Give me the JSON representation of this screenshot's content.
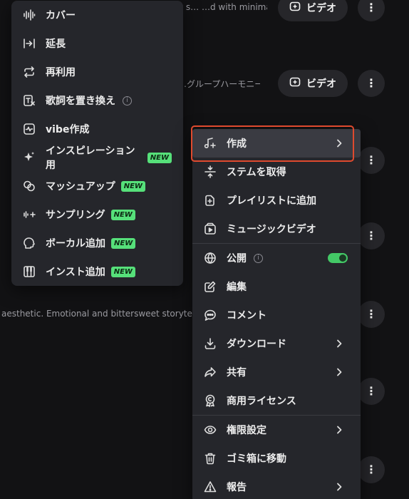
{
  "background": {
    "row1_text": "y s… …d with minimal arr…",
    "row2_text": "…グループハーモニー…",
    "row3_text": "aesthetic. Emotional and bittersweet storytel",
    "video_label": "ビデオ",
    "dots": "⋮"
  },
  "left_menu": {
    "items": [
      {
        "label": "カバー",
        "icon": "waveform-icon"
      },
      {
        "label": "延長",
        "icon": "extend-arrow-icon"
      },
      {
        "label": "再利用",
        "icon": "repeat-icon"
      },
      {
        "label": "歌詞を置き換え",
        "icon": "lyrics-replace-icon",
        "info": "i"
      },
      {
        "label": "vibe作成",
        "icon": "vibe-icon"
      },
      {
        "label": "インスピレーション用",
        "icon": "sparkle-icon",
        "badge": "NEW"
      },
      {
        "label": "マッシュアップ",
        "icon": "mashup-icon",
        "badge": "NEW"
      },
      {
        "label": "サンプリング",
        "icon": "sampling-icon",
        "badge": "NEW"
      },
      {
        "label": "ボーカル追加",
        "icon": "vocal-head-icon",
        "badge": "NEW"
      },
      {
        "label": "インスト追加",
        "icon": "piano-icon",
        "badge": "NEW"
      }
    ]
  },
  "right_menu": {
    "items": [
      {
        "label": "作成",
        "icon": "music-create-icon",
        "chevron": true
      },
      {
        "label": "ステムを取得",
        "icon": "stems-icon"
      },
      {
        "label": "プレイリストに追加",
        "icon": "playlist-add-icon"
      },
      {
        "label": "ミュージックビデオ",
        "icon": "music-video-icon"
      },
      {
        "label": "公開",
        "icon": "globe-icon",
        "info": "i",
        "toggle": true
      },
      {
        "label": "編集",
        "icon": "edit-icon"
      },
      {
        "label": "コメント",
        "icon": "comment-icon"
      },
      {
        "label": "ダウンロード",
        "icon": "download-icon",
        "chevron": true
      },
      {
        "label": "共有",
        "icon": "share-icon",
        "chevron": true
      },
      {
        "label": "商用ライセンス",
        "icon": "license-icon"
      },
      {
        "label": "権限設定",
        "icon": "eye-icon",
        "chevron": true
      },
      {
        "label": "ゴミ箱に移動",
        "icon": "trash-icon"
      },
      {
        "label": "報告",
        "icon": "warning-icon",
        "chevron": true
      }
    ]
  },
  "colors": {
    "highlight": "#e04a2e",
    "badge": "#56e07a",
    "toggle_on": "#43c866"
  }
}
